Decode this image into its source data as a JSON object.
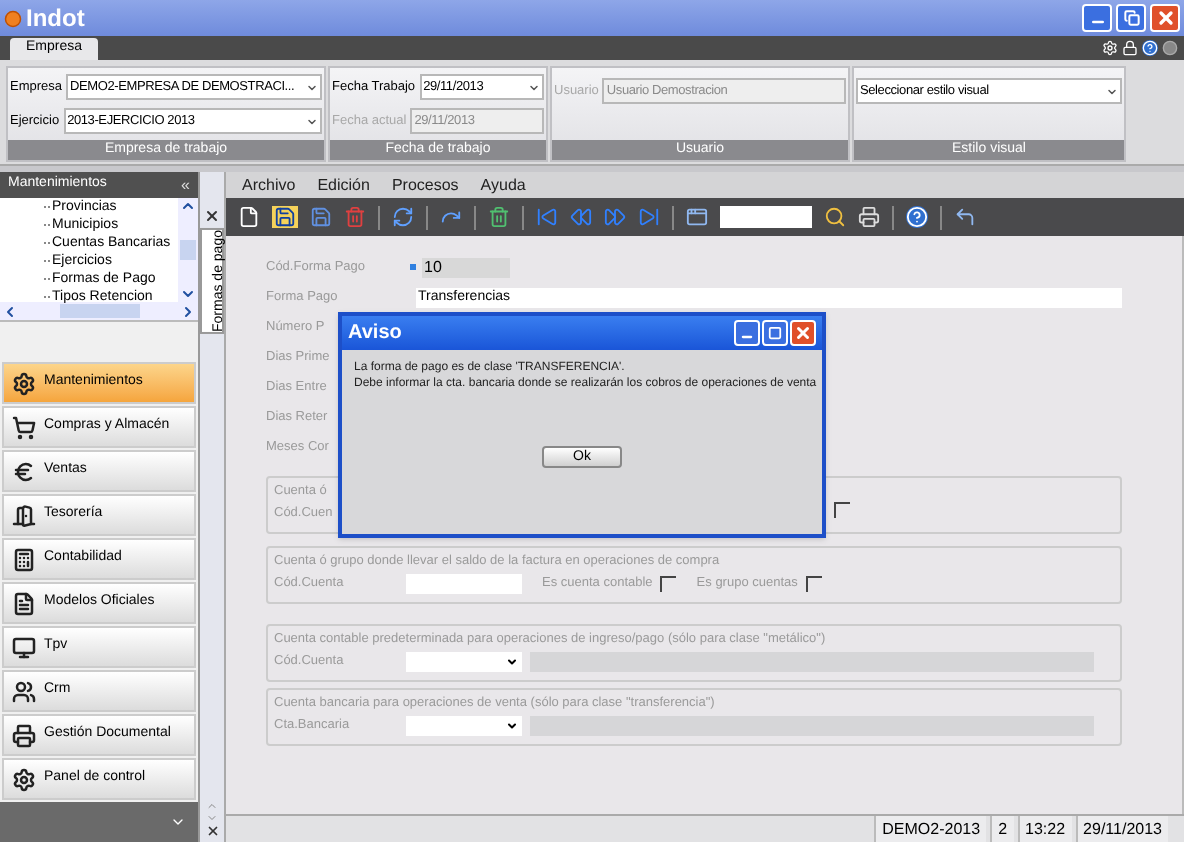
{
  "window": {
    "title": "Indot"
  },
  "ribbon_tabs": [
    {
      "label": "Empresa",
      "selected": true
    }
  ],
  "ribbon_groups": [
    {
      "title": "Empresa de trabajo",
      "fields": [
        {
          "label": "Empresa",
          "value": "DEMO2-EMPRESA DE DEMOSTRACI...",
          "kind": "combo",
          "disabled": false
        },
        {
          "label": "Ejercicio",
          "value": "2013-EJERCICIO 2013",
          "kind": "combo",
          "disabled": false
        }
      ]
    },
    {
      "title": "Fecha de trabajo",
      "fields": [
        {
          "label": "Fecha Trabajo",
          "value": "29/11/2013",
          "kind": "combo",
          "disabled": false
        },
        {
          "label": "Fecha actual",
          "value": "29/11/2013",
          "kind": "text",
          "disabled": true
        }
      ]
    },
    {
      "title": "Usuario",
      "fields": [
        {
          "label": "Usuario",
          "value": "Usuario Demostracion",
          "kind": "text",
          "disabled": true
        }
      ]
    },
    {
      "title": "Estilo visual",
      "fields": [
        {
          "value": "Seleccionar estilo visual",
          "kind": "combo",
          "disabled": false
        }
      ]
    }
  ],
  "sidebar": {
    "title": "Mantenimientos",
    "collapse": "«",
    "tree_items": [
      {
        "label": "Provincias"
      },
      {
        "label": "Municipios"
      },
      {
        "label": "Cuentas Bancarias"
      },
      {
        "label": "Ejercicios"
      },
      {
        "label": "Formas de Pago"
      },
      {
        "label": "Tipos Retencion"
      }
    ],
    "nav_items": [
      {
        "label": "Mantenimientos",
        "selected": true
      },
      {
        "label": "Compras y Almacén",
        "selected": false
      },
      {
        "label": "Ventas",
        "selected": false
      },
      {
        "label": "Tesorería",
        "selected": false
      },
      {
        "label": "Contabilidad",
        "selected": false
      },
      {
        "label": "Modelos Oficiales",
        "selected": false
      },
      {
        "label": "Tpv",
        "selected": false
      },
      {
        "label": "Crm",
        "selected": false
      },
      {
        "label": "Gestión Documental",
        "selected": false
      },
      {
        "label": "Panel de control",
        "selected": false
      }
    ]
  },
  "document_tabs": [
    {
      "label": "Formas de pago",
      "selected": true
    }
  ],
  "menu": [
    {
      "label": "Archivo"
    },
    {
      "label": "Edición"
    },
    {
      "label": "Procesos"
    },
    {
      "label": "Ayuda"
    }
  ],
  "form": {
    "fields": [
      {
        "label": "Cód.Forma Pago",
        "value": "10",
        "kind": "code"
      },
      {
        "label": "Forma Pago",
        "value": "Transferencias",
        "kind": "wide"
      },
      {
        "label": "Número P",
        "kind": "label"
      },
      {
        "label": "Dias Prime",
        "kind": "label"
      },
      {
        "label": "Dias Entre",
        "kind": "label"
      },
      {
        "label": "Dias Reter",
        "kind": "label"
      },
      {
        "label": "Meses Cor",
        "kind": "label"
      }
    ],
    "groups": [
      {
        "legend": "Cuenta ó",
        "kind": "hidden",
        "label": "Cód.Cuen",
        "checks": [
          {
            "checked": false
          }
        ]
      },
      {
        "legend": "Cuenta ó grupo donde llevar el saldo de la factura en operaciones de compra",
        "kind": "checks",
        "label": "Cód.Cuenta",
        "checks": [
          {
            "label": "Es cuenta contable",
            "checked": false
          },
          {
            "label": "Es grupo cuentas",
            "checked": false
          }
        ]
      },
      {
        "legend": "Cuenta contable predeterminada para operaciones de ingreso/pago (sólo para clase \"metálico\")",
        "kind": "combo",
        "label": "Cód.Cuenta"
      },
      {
        "legend": "Cuenta bancaria para operaciones de venta (sólo para clase \"transferencia\")",
        "kind": "combo",
        "label": "Cta.Bancaria"
      }
    ]
  },
  "dialog": {
    "title": "Aviso",
    "message_lines": [
      "La forma de pago es de clase 'TRANSFERENCIA'.",
      "Debe informar la cta. bancaria donde se realizarán los cobros de operaciones de venta"
    ],
    "button": "Ok"
  },
  "status_bar": [
    "DEMO2-2013",
    "2",
    "13:22",
    "29/11/2013"
  ]
}
